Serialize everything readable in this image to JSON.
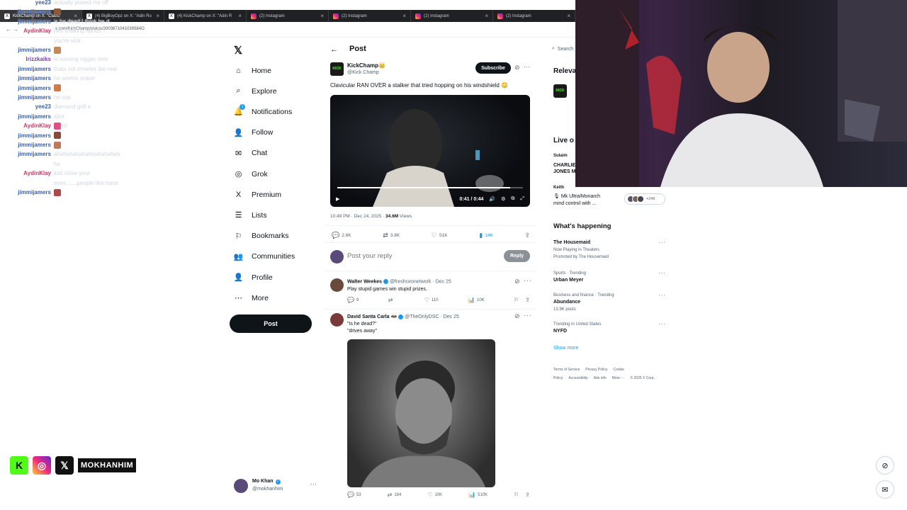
{
  "browser": {
    "tabs": [
      {
        "label": "KickChamp on X: \"Clavic",
        "icon": "x"
      },
      {
        "label": "(4) BigBoyOpz on X: \"Adin Ro",
        "icon": "x"
      },
      {
        "label": "(4) KickChamp on X: \"Adin R",
        "icon": "x"
      },
      {
        "label": "(2) Instagram",
        "icon": "ig"
      },
      {
        "label": "(2) Instagram",
        "icon": "ig"
      },
      {
        "label": "(2) Instagram",
        "icon": "ig"
      },
      {
        "label": "(2) Instagram",
        "icon": "ig"
      }
    ],
    "url": "x.com/KickChamp/status/2003671041039584O"
  },
  "chat": [
    {
      "user": "yee23",
      "msg": "actually pissed me off",
      "color": "blue"
    },
    {
      "user": "jimmijamers",
      "msg": "",
      "color": "blue",
      "emote": "#8a5a3a"
    },
    {
      "user": "jimmijamers",
      "msg": "is he dead I think he d",
      "color": "blue"
    },
    {
      "user": "AydinKlay",
      "msg": "hes shaking hands",
      "color": "pink"
    },
    {
      "user": "",
      "msg": "you're sick",
      "color": "blue"
    },
    {
      "user": "jimmijamers",
      "msg": "",
      "color": "blue",
      "emote": "#c58a5a"
    },
    {
      "user": "Irizzkaiks",
      "msg": "w running nigger over",
      "color": "purple"
    },
    {
      "user": "jimmijamers",
      "msg": "thats not smarter tbe real",
      "color": "blue"
    },
    {
      "user": "jimmijamers",
      "msg": "he seems sniper",
      "color": "blue"
    },
    {
      "user": "jimmijamers",
      "msg": "",
      "color": "blue",
      "emote": "#d07a4a"
    },
    {
      "user": "jimmijamers",
      "msg": "he cop",
      "color": "blue"
    },
    {
      "user": "yee23",
      "msg": "diamond grill e",
      "color": "blue"
    },
    {
      "user": "jimmijamers",
      "msg": "idiot",
      "color": "blue"
    },
    {
      "user": "AydinKlay",
      "msg": "lol",
      "color": "pink",
      "emote": "#e05080"
    },
    {
      "user": "jimmijamers",
      "msg": "",
      "color": "blue",
      "emote": "#8a4a3a"
    },
    {
      "user": "jimmijamers",
      "msg": "",
      "color": "blue",
      "emote": "#c07a5a"
    },
    {
      "user": "jimmijamers",
      "msg": "ahahahahahahhahahahah",
      "color": "blue"
    },
    {
      "user": "",
      "msg": "ha",
      "color": "blue"
    },
    {
      "user": "AydinKlay",
      "msg": "just close your",
      "color": "pink"
    },
    {
      "user": "",
      "msg": "eyes.......people like trans",
      "color": "blue"
    },
    {
      "user": "jimmijamers",
      "msg": "",
      "color": "blue",
      "emote": "#b04a4a"
    }
  ],
  "nav": {
    "items": [
      {
        "label": "Home",
        "icon": "⌂",
        "name": "home"
      },
      {
        "label": "Explore",
        "icon": "⌕",
        "name": "explore"
      },
      {
        "label": "Notifications",
        "icon": "🔔",
        "name": "notifications",
        "badge": "1"
      },
      {
        "label": "Follow",
        "icon": "👤",
        "name": "follow"
      },
      {
        "label": "Chat",
        "icon": "✉",
        "name": "chat"
      },
      {
        "label": "Grok",
        "icon": "◎",
        "name": "grok"
      },
      {
        "label": "Premium",
        "icon": "X",
        "name": "premium"
      },
      {
        "label": "Lists",
        "icon": "☰",
        "name": "lists"
      },
      {
        "label": "Bookmarks",
        "icon": "⚐",
        "name": "bookmarks"
      },
      {
        "label": "Communities",
        "icon": "👥",
        "name": "communities"
      },
      {
        "label": "Profile",
        "icon": "👤",
        "name": "profile"
      },
      {
        "label": "More",
        "icon": "⋯",
        "name": "more"
      }
    ],
    "post_label": "Post",
    "account_name": "Mo Khan",
    "account_handle": "@mokhanhim"
  },
  "post": {
    "header": "Post",
    "author_name": "KickChamp👑",
    "author_handle": "@Kick Champ",
    "avatar_text": "KICK",
    "subscribe": "Subscribe",
    "text": "Clavicular RAN OVER a stalker that tried hopping on his windshield 😳",
    "video_time": "0:41 / 0:44",
    "video_progress": 0.93,
    "meta_time": "10:49 PM · Dec 24, 2025 · ",
    "meta_views": "34.6M",
    "meta_views_label": " Views",
    "replies": "2.8K",
    "reposts": "3.8K",
    "likes": "51K",
    "bookmarks": "14K",
    "reply_placeholder": "Post your reply",
    "reply_btn": "Reply"
  },
  "replies": [
    {
      "name": "Walter Weekes",
      "handle": "@freshceonetwork · Dec 25",
      "text1": "Play stupid games win stupid prizes.",
      "text2": "",
      "replies": "9",
      "reposts": "",
      "likes": "110",
      "views": "10K",
      "avatar_color": "#6a4a3a"
    },
    {
      "name": "David Santa Carla 🦇",
      "handle": "@TheOnlyDSC · Dec 25",
      "text1": "\"Is he dead?\"",
      "text2": "\"drives away\"",
      "replies": "53",
      "reposts": "184",
      "likes": "10K",
      "views": "510K",
      "avatar_color": "#7a3a3a"
    }
  ],
  "sidebar": {
    "search_placeholder": "Search",
    "relevant_title": "Releva",
    "live_title": "Live o",
    "live_1": "Sulaim",
    "live_1_text": "CHARLIE",
    "live_1_text2": "JONES M",
    "live_2_name": "Keith",
    "live_2_text": "🎙 Mk Ultra/Monarch",
    "live_2_text2": "mind control with ...",
    "live_count": "+249",
    "happening_title": "What's happening",
    "trends": [
      {
        "cat": "",
        "name": "The Housemaid",
        "sub": "Now Playing in Theaters",
        "sub2": "Promoted by The Housemaid"
      },
      {
        "cat": "Sports · Trending",
        "name": "Urban Meyer",
        "sub": "",
        "sub2": ""
      },
      {
        "cat": "Business and finance · Trending",
        "name": "Abundance",
        "sub": "13.9K posts",
        "sub2": ""
      },
      {
        "cat": "Trending in United States",
        "name": "NYFD",
        "sub": "",
        "sub2": ""
      }
    ],
    "show_more": "Show more",
    "footer": [
      "Terms of Service",
      "Privacy Policy",
      "Cookie Policy",
      "Accessibility",
      "Ads info",
      "More ···",
      "© 2025 X Corp."
    ]
  },
  "overlay": {
    "handle": "MOKHANHIM"
  },
  "colors": {
    "accent": "#1d9bf0",
    "kick_green": "#53fc18"
  }
}
